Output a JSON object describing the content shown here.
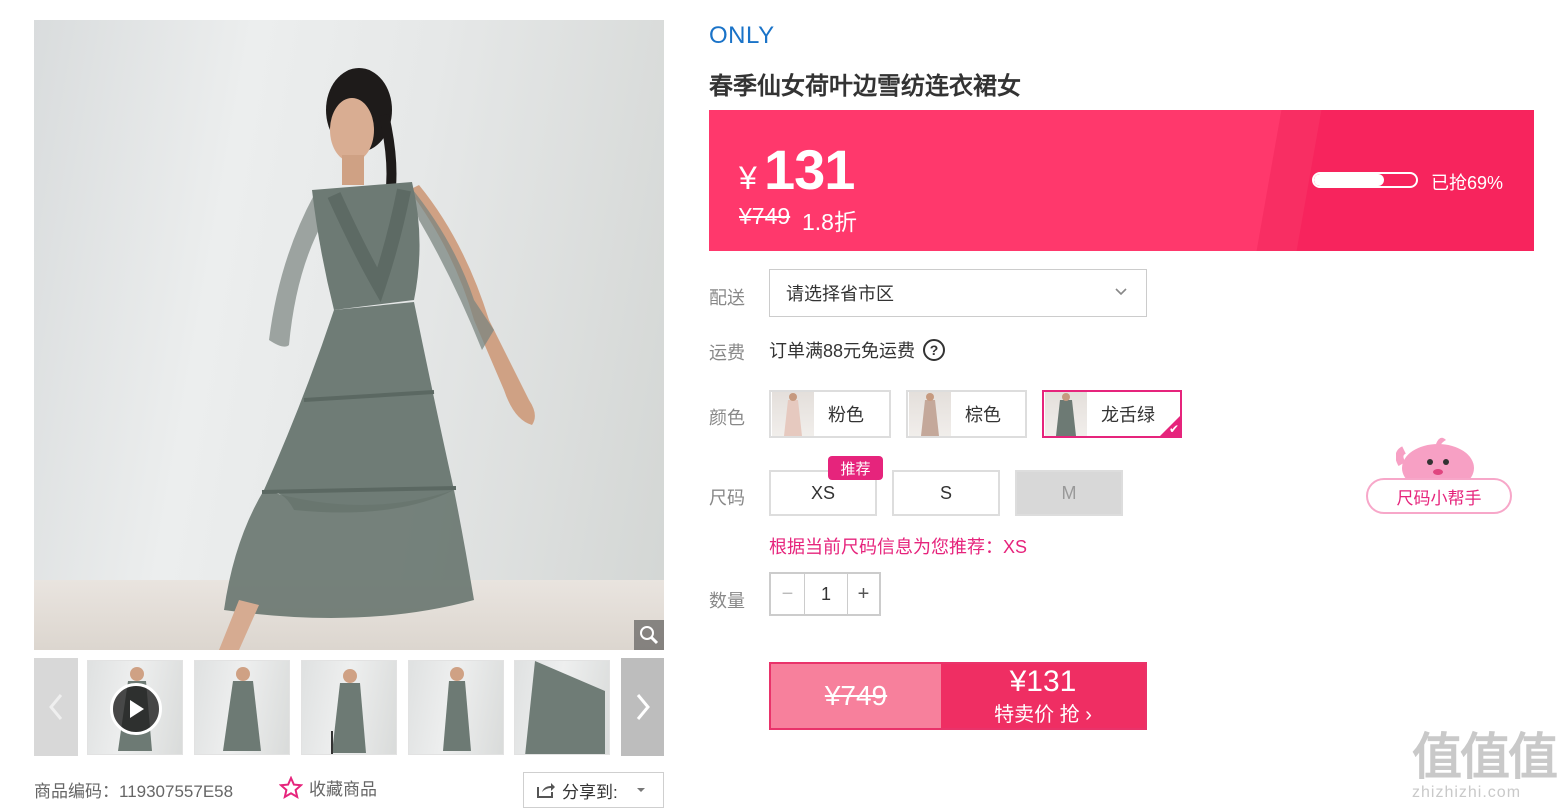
{
  "gallery": {
    "code_label": "商品编码：119307557E58",
    "favorite_label": "收藏商品",
    "share_label": "分享到:",
    "thumbnail_count": 5
  },
  "product": {
    "brand": "ONLY",
    "title": "春季仙女荷叶边雪纺连衣裙女"
  },
  "price": {
    "currency": "¥",
    "current": "131",
    "original": "¥749",
    "discount": "1.8折",
    "sold_percent": 69,
    "sold_label": "已抢69%"
  },
  "delivery": {
    "label": "配送",
    "placeholder": "请选择省市区"
  },
  "shipping": {
    "label": "运费",
    "text": "订单满88元免运费",
    "help": "?"
  },
  "color": {
    "label": "颜色",
    "options": [
      {
        "name": "粉色",
        "selected": false
      },
      {
        "name": "棕色",
        "selected": false
      },
      {
        "name": "龙舌绿",
        "selected": true
      }
    ]
  },
  "size": {
    "label": "尺码",
    "options": [
      {
        "name": "XS",
        "available": true
      },
      {
        "name": "S",
        "available": true
      },
      {
        "name": "M",
        "available": false
      }
    ],
    "recommend_tag": "推荐",
    "recommend_text": "根据当前尺码信息为您推荐：XS",
    "helper_label": "尺码小帮手"
  },
  "quantity": {
    "label": "数量",
    "value": "1",
    "minus": "−",
    "plus": "+"
  },
  "buy": {
    "original": "¥749",
    "price": "¥131",
    "label": "特卖价 抢 ›"
  },
  "watermark": {
    "big": "值值值",
    "small": "zhizhizhi.com"
  },
  "colors": {
    "accent": "#ff386c",
    "brand_blue": "#1a73c8",
    "pink": "#e6247c"
  }
}
